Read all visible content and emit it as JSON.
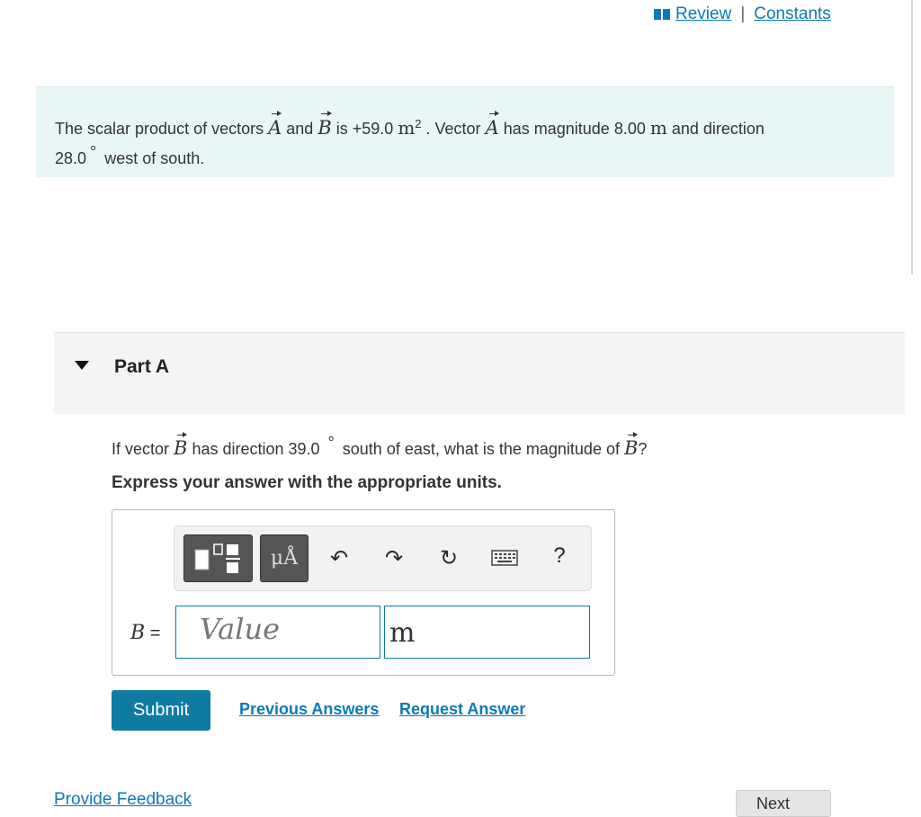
{
  "top_links": {
    "review": "Review",
    "separator": "|",
    "constants": "Constants"
  },
  "intro": {
    "t1": "The scalar product of vectors ",
    "vecA": "A",
    "t2": " and ",
    "vecB": "B",
    "t3": " is +59.0 ",
    "unit_m": "m",
    "exp2": "2",
    "t4": " . Vector ",
    "t5": " has magnitude 8.00 ",
    "t6": " and direction",
    "t7": "28.0",
    "deg": "°",
    "t8": " west of south."
  },
  "part": {
    "title": "Part A"
  },
  "question": {
    "q1": "If vector ",
    "q2": " has direction 39.0 ",
    "q3": " south of east, what is the magnitude of ",
    "q4": "?"
  },
  "instruction": "Express your answer with the appropriate units.",
  "toolbar": {
    "units_label": "μÅ",
    "undo": "↶",
    "redo": "↷",
    "reset": "↻",
    "help": "?"
  },
  "answer": {
    "label_var": "B",
    "label_eq": " =",
    "value_placeholder": "Value",
    "unit_value": "m"
  },
  "actions": {
    "submit": "Submit",
    "previous_answers": "Previous Answers",
    "request_answer": "Request Answer"
  },
  "footer": {
    "feedback": "Provide Feedback",
    "next": "Next"
  }
}
